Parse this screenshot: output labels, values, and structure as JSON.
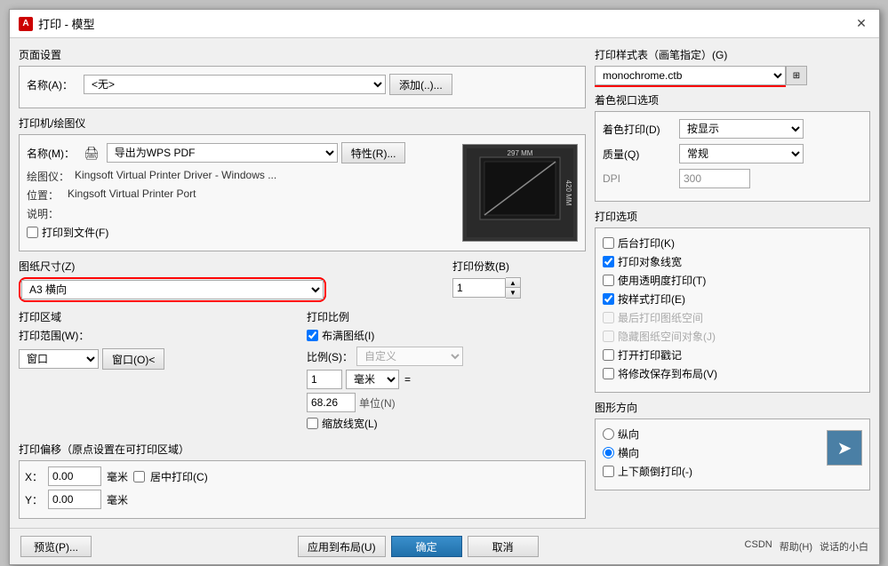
{
  "title": "打印 - 模型",
  "title_icon": "A",
  "sections": {
    "page_setup": {
      "label": "页面设置",
      "name_label": "名称(A)：",
      "name_value": "<无>",
      "add_btn": "添加(..)..."
    },
    "printer": {
      "label": "打印机/绘图仪",
      "name_label": "名称(M)：",
      "name_value": "导出为WPS PDF",
      "props_btn": "特性(R)...",
      "plotter_label": "绘图仪：",
      "plotter_value": "Kingsoft Virtual Printer Driver - Windows ...",
      "location_label": "位置：",
      "location_value": "Kingsoft Virtual Printer Port",
      "description_label": "说明：",
      "description_value": "",
      "print_to_file_label": "打印到文件(F)"
    },
    "paper_size": {
      "label": "图纸尺寸(Z)",
      "value": "A3 横向"
    },
    "preview": {
      "width": "297 MM",
      "height": "420 MM"
    },
    "print_copies": {
      "label": "打印份数(B)",
      "value": "1"
    },
    "print_area": {
      "label": "打印区域",
      "range_label": "打印范围(W)：",
      "range_value": "窗口",
      "window_btn": "窗口(O)<"
    },
    "print_scale": {
      "label": "打印比例",
      "fill_paper_label": "布满图纸(I)",
      "fill_paper_checked": true,
      "scale_label": "比例(S)：",
      "scale_value": "自定义",
      "value1": "1",
      "unit1": "毫米",
      "value2": "68.26",
      "unit_label": "单位(N)",
      "zoom_linewidth_label": "缩放线宽(L)"
    },
    "print_offset": {
      "label": "打印偏移（原点设置在可打印区域）",
      "x_label": "X：",
      "x_value": "0.00",
      "x_unit": "毫米",
      "center_print_label": "居中打印(C)",
      "y_label": "Y：",
      "y_value": "0.00",
      "y_unit": "毫米"
    },
    "print_style": {
      "label": "打印样式表（画笔指定）(G)",
      "value": "monochrome.ctb",
      "color_btn": "■"
    },
    "color_window": {
      "label": "着色视口选项",
      "color_print_label": "着色打印(D)",
      "color_print_value": "按显示",
      "quality_label": "质量(Q)",
      "quality_value": "常规",
      "dpi_label": "DPI",
      "dpi_value": "300"
    },
    "print_options": {
      "label": "打印选项",
      "options": [
        {
          "label": "后台打印(K)",
          "checked": false
        },
        {
          "label": "打印对象线宽",
          "checked": true
        },
        {
          "label": "使用透明度打印(T)",
          "checked": false
        },
        {
          "label": "按样式打印(E)",
          "checked": true
        },
        {
          "label": "最后打印图纸空间",
          "checked": false,
          "disabled": true
        },
        {
          "label": "隐藏图纸空间对象(J)",
          "checked": false,
          "disabled": true
        },
        {
          "label": "打开打印戳记",
          "checked": false
        },
        {
          "label": "将修改保存到布局(V)",
          "checked": false
        }
      ]
    },
    "orientation": {
      "label": "图形方向",
      "options": [
        {
          "label": "纵向",
          "checked": false
        },
        {
          "label": "横向",
          "checked": true
        },
        {
          "label": "上下颠倒打印(-)",
          "checked": false
        }
      ]
    }
  },
  "footer": {
    "preview_btn": "预览(P)...",
    "apply_btn": "应用到布局(U)",
    "ok_btn": "确定",
    "cancel_btn": "取消",
    "links": [
      "CSDN",
      "帮助(H)",
      "说话的小白"
    ]
  }
}
